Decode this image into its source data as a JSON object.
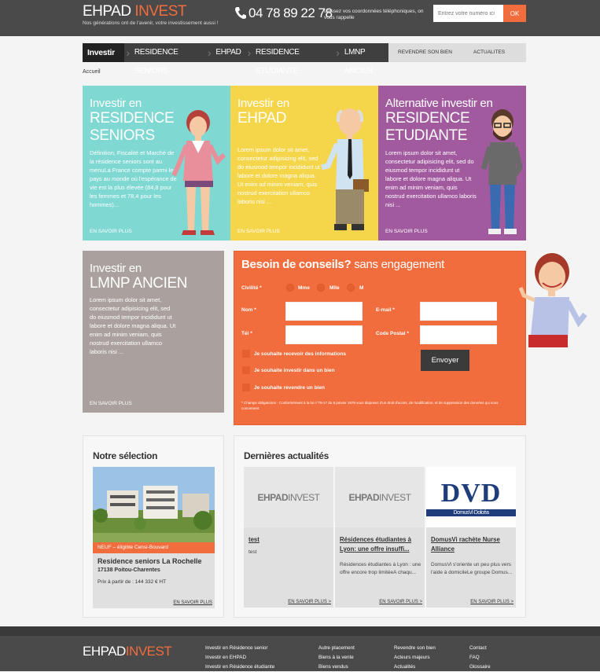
{
  "header": {
    "logo_main": "EHPAD",
    "logo_accent": "INVEST",
    "tagline": "Nos générations ont de l'avenir, votre investissement aussi !",
    "phone": "04 78 89 22 78",
    "callback_text": "Laissez vos coordonnées téléphoniques, on vous rappelle",
    "number_placeholder": "Entrez votre numéro ici",
    "ok_label": "OK"
  },
  "nav": {
    "items": [
      "Investir en",
      "RESIDENCE SENIORS",
      "EHPAD",
      "RESIDENCE ETUDIANTE",
      "LMNP ANCIEN"
    ],
    "right_items": [
      "REVENDRE SON BIEN",
      "ACTUALITES"
    ]
  },
  "breadcrumb": "Accueil",
  "cards": [
    {
      "small": "Investir en",
      "big": [
        "RESIDENCE",
        "SENIORS"
      ],
      "text": "Définition, Fiscalité et Marché de la résidence seniors sont au menuLa France compte parmi les pays au monde où l'espérance de vie est la plus élevée (84,8 pour les femmes et 78,4 pour les hommes)...",
      "more": "EN SAVOIR PLUS",
      "color": "#7fd8d2"
    },
    {
      "small": "Investir en",
      "big": [
        "EHPAD"
      ],
      "text": "Lorem ipsum dolor sit amet, consectetur adipisicing elit, sed do eiusmod tempor incididunt ut labore et dolore magna aliqua. Ut enim ad minim veniam, quis nostrud exercitation ullamco laboris nisi ...",
      "more": "EN SAVOIR PLUS",
      "color": "#f5d64b"
    },
    {
      "small": "Alternative investir en",
      "big": [
        "RESIDENCE",
        "ETUDIANTE"
      ],
      "text": "Lorem ipsum dolor sit amet, consectetur adipisicing elit, sed do eiusmod tempor incididunt ut labore et dolore magna aliqua. Ut enim ad minim veniam, quis nostrud exercitation ullamco laboris nisi ...",
      "more": "EN SAVOIR PLUS",
      "color": "#a25a9f"
    },
    {
      "small": "Investir en",
      "big": [
        "LMNP ANCIEN"
      ],
      "text": "Lorem ipsum dolor sit amet, consectetur adipisicing elit, sed do eiusmod tempor incididunt ut labore et dolore magna aliqua. Ut enim ad minim veniam, quis nostrud exercitation ullamco laboris nisi ...",
      "more": "EN SAVOIR PLUS",
      "color": "#aaa19e"
    }
  ],
  "form": {
    "title_bold": "Besoin de conseils?",
    "title_rest": "sans engagement",
    "civilite_label": "Civilité *",
    "civilites": [
      "Mme",
      "Mlle",
      "M"
    ],
    "nom_label": "Nom *",
    "email_label": "E-mail *",
    "tel_label": "Tél *",
    "postal_label": "Code Postal *",
    "checks": [
      "Je souhaite recevoir des informations",
      "Je souhaite investir dans un bien",
      "Je souhaite revendre un bien"
    ],
    "send_label": "Envoyer",
    "legal": "* Champs obligatoires - Conformément à la loi n°78-17 du 6 janvier 1978 vous disposez d'un droit d'accès, de modification, et de suppression des données qui vous concernent."
  },
  "selection": {
    "title": "Notre sélection",
    "badge": "NEUF – éligible Censi-Bouvard",
    "name": "Residence seniors La Rochelle",
    "location": "17138 Poitou-Charentes",
    "price": "Prix à partir de : 144 332 € HT",
    "more": "EN SAVOIR PLUS"
  },
  "news": {
    "title": "Dernières actualités",
    "thumb_main": "EHPAD",
    "thumb_accent": "INVEST",
    "items": [
      {
        "title": "test",
        "text": "test",
        "more": "EN SAVOIR PLUS >"
      },
      {
        "title": "Résidences étudiantes à Lyon: une offre insuffi...",
        "text": "Résidences étudiantes à Lyon : une offre encore trop limitéeA chaqu...",
        "more": "EN SAVOIR PLUS >"
      },
      {
        "title": "DomusVi rachète Nurse Alliance",
        "text": "DomusVi s'oriente un peu plus vers l'aide à domicileLe groupe Domus...",
        "more": "EN SAVOIR PLUS >",
        "logo_letters": "DVD",
        "logo_caption": "DomusVi Dolcéa"
      }
    ]
  },
  "footer": {
    "logo_main": "EHPAD",
    "logo_accent": "INVEST",
    "col1": [
      "Investir en Résidence senior",
      "Investir en EHPAD",
      "Investir en Résidence étudiante"
    ],
    "col2": [
      "Autre placement",
      "Biens à la vente",
      "Biens vendus"
    ],
    "col3": [
      "Revendre son bien",
      "Acteurs majeurs",
      "Actualités"
    ],
    "col4": [
      "Contact",
      "FAQ",
      "Glossaire"
    ]
  }
}
